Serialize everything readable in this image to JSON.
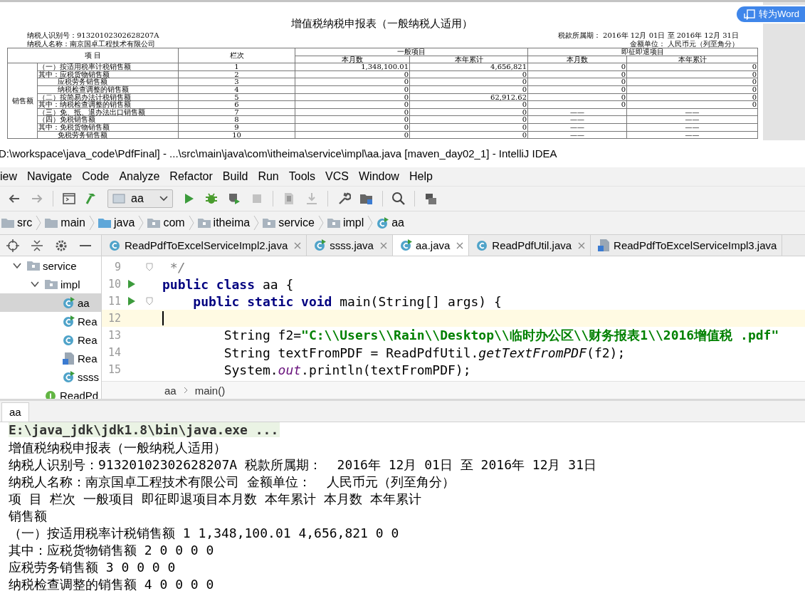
{
  "pdf": {
    "title": "增值税纳税申报表（一般纳税人适用）",
    "taxpayer_id": "纳税人识别号：91320102302628207A",
    "taxpayer_name": "纳税人名称：南京国卓工程技术有限公司",
    "period": "税款所属期：  2016年 12月 01日 至 2016年 12月 31日",
    "unit": "金额单位：  人民币元（列至角分）",
    "headers": {
      "item": "项 目",
      "line": "栏次",
      "general": "一般项目",
      "refund": "即征即退项目",
      "sub": [
        "本月数",
        "本年累计",
        "本月数",
        "本年累计"
      ]
    },
    "category": "销售额",
    "rows": [
      {
        "kind": "plain",
        "item": "（一）按适用税率计税销售额",
        "line": "1",
        "cells": [
          "1,348,100.01",
          "4,656,821",
          "0",
          "0"
        ]
      },
      {
        "kind": "plain",
        "item": "其中：应税货物销售额",
        "line": "2",
        "cells": [
          "0",
          "0",
          "0",
          "0"
        ]
      },
      {
        "kind": "indented",
        "item": "应税劳务销售额",
        "line": "3",
        "cells": [
          "0",
          "0",
          "0",
          "0"
        ]
      },
      {
        "kind": "indented",
        "item": "纳税检查调整的销售额",
        "line": "4",
        "cells": [
          "0",
          "0",
          "0",
          "0"
        ]
      },
      {
        "kind": "plain",
        "item": "（二）按简易办法计税销售额",
        "line": "5",
        "cells": [
          "0",
          "62,912.62",
          "0",
          "0"
        ]
      },
      {
        "kind": "plain",
        "item": "其中：纳税检查调整的销售额",
        "line": "6",
        "cells": [
          "0",
          "0",
          "0",
          "0"
        ]
      },
      {
        "kind": "plain",
        "item": "（三）免、抵、退办法出口销售额",
        "line": "7",
        "cells": [
          "0",
          "0",
          "——",
          "——"
        ]
      },
      {
        "kind": "plain",
        "item": "（四）免税销售额",
        "line": "8",
        "cells": [
          "0",
          "0",
          "——",
          "——"
        ]
      },
      {
        "kind": "plain",
        "item": "其中：免税货物销售额",
        "line": "9",
        "cells": [
          "0",
          "0",
          "——",
          "——"
        ]
      },
      {
        "kind": "indented",
        "item": "免税劳务销售额",
        "line": "10",
        "cells": [
          "0",
          "0",
          "——",
          "——"
        ]
      }
    ],
    "word_button": "转为Word"
  },
  "ide": {
    "title": "D:\\workspace\\java_code\\PdfFinal] - ...\\src\\main\\java\\com\\itheima\\service\\impl\\aa.java [maven_day02_1] - IntelliJ IDEA",
    "menu": [
      "iew",
      "Navigate",
      "Code",
      "Analyze",
      "Refactor",
      "Build",
      "Run",
      "Tools",
      "VCS",
      "Window",
      "Help"
    ],
    "run_config": "aa",
    "breadcrumb": [
      {
        "label": "src",
        "kind": "folder"
      },
      {
        "label": "main",
        "kind": "folder"
      },
      {
        "label": "java",
        "kind": "source"
      },
      {
        "label": "com",
        "kind": "package"
      },
      {
        "label": "itheima",
        "kind": "package"
      },
      {
        "label": "service",
        "kind": "package"
      },
      {
        "label": "impl",
        "kind": "package"
      },
      {
        "label": "aa",
        "kind": "runnable"
      }
    ],
    "tree": [
      {
        "label": "service",
        "kind": "package",
        "expanded": true,
        "selected": false,
        "children": [
          {
            "label": "impl",
            "kind": "package",
            "expanded": true,
            "selected": false,
            "children": [
              {
                "label": "aa",
                "kind": "runnable",
                "selected": true
              },
              {
                "label": "Rea",
                "kind": "runnable",
                "selected": false
              },
              {
                "label": "Rea",
                "kind": "class",
                "selected": false
              },
              {
                "label": "Rea",
                "kind": "file",
                "selected": false
              },
              {
                "label": "ssss",
                "kind": "runnable",
                "selected": false
              }
            ]
          },
          {
            "label": "ReadPd",
            "kind": "interface",
            "selected": false
          }
        ]
      }
    ],
    "tabs": [
      {
        "label": "ReadPdfToExcelServiceImpl2.java",
        "kind": "class",
        "selected": false
      },
      {
        "label": "ssss.java",
        "kind": "runnable",
        "selected": false
      },
      {
        "label": "aa.java",
        "kind": "runnable",
        "selected": true
      },
      {
        "label": "ReadPdfUtil.java",
        "kind": "class",
        "selected": false
      },
      {
        "label": "ReadPdfToExcelServiceImpl3.java",
        "kind": "file",
        "selected": false
      }
    ],
    "lines": [
      {
        "number": "9",
        "run": false,
        "fold": true,
        "current": false,
        "tokens": [
          {
            "kind": "comment",
            "text": " */"
          }
        ]
      },
      {
        "number": "10",
        "run": true,
        "fold": false,
        "current": false,
        "tokens": [
          {
            "kind": "keyword",
            "text": "public class "
          },
          {
            "kind": "plain",
            "text": "aa {"
          }
        ]
      },
      {
        "number": "11",
        "run": true,
        "fold": true,
        "current": false,
        "tokens": [
          {
            "kind": "keyword",
            "text": "    public static void "
          },
          {
            "kind": "plain",
            "text": "main(String[] args) {"
          }
        ]
      },
      {
        "number": "12",
        "run": false,
        "fold": false,
        "current": true
      },
      {
        "number": "13",
        "run": false,
        "fold": false,
        "current": false,
        "tokens": [
          {
            "kind": "plain",
            "text": "        String f2="
          },
          {
            "kind": "string",
            "text": "\"C:\\\\Users\\\\Rain\\\\Desktop\\\\临时办公区\\\\财务报表1\\\\2016增值税 .pdf\""
          }
        ]
      },
      {
        "number": "14",
        "run": false,
        "fold": false,
        "current": false,
        "tokens": [
          {
            "kind": "plain",
            "text": "        String textFromPDF = ReadPdfUtil."
          },
          {
            "kind": "method",
            "text": "getTextFromPDF"
          },
          {
            "kind": "plain",
            "text": "(f2);"
          }
        ]
      },
      {
        "number": "15",
        "run": false,
        "fold": false,
        "current": false,
        "tokens": [
          {
            "kind": "plain",
            "text": "        System."
          },
          {
            "kind": "static",
            "text": "out"
          },
          {
            "kind": "plain",
            "text": ".println(textFromPDF);"
          }
        ]
      }
    ],
    "editor_breadcrumb": [
      "aa",
      "main()"
    ],
    "run_tab": "aa",
    "console": [
      {
        "kind": "command",
        "text": "E:\\java_jdk\\jdk1.8\\bin\\java.exe ..."
      },
      {
        "kind": "output",
        "text": "增值税纳税申报表（一般纳税人适用）"
      },
      {
        "kind": "output",
        "text": "纳税人识别号：91320102302628207A 税款所属期：  2016年 12月 01日 至 2016年 12月 31日"
      },
      {
        "kind": "output",
        "text": "纳税人名称：南京国卓工程技术有限公司 金额单位：  人民币元（列至角分）"
      },
      {
        "kind": "output",
        "text": "项 目 栏次 一般项目 即征即退项目本月数 本年累计 本月数 本年累计"
      },
      {
        "kind": "output",
        "text": "销售额"
      },
      {
        "kind": "output",
        "text": "（一）按适用税率计税销售额 1 1,348,100.01 4,656,821 0 0"
      },
      {
        "kind": "output",
        "text": "其中：应税货物销售额 2 0 0 0 0"
      },
      {
        "kind": "output",
        "text": "应税劳务销售额 3 0 0 0 0"
      },
      {
        "kind": "output",
        "text": "纳税检查调整的销售额 4 0 0 0 0"
      }
    ]
  }
}
